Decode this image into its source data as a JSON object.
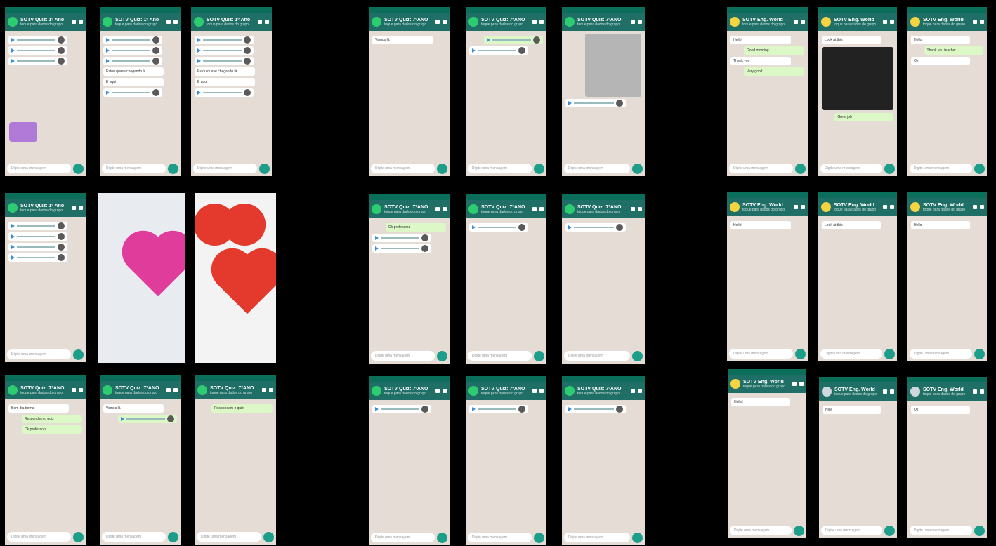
{
  "input_placeholder": "Digite uma mensagem",
  "groups": [
    {
      "title": "SOTV Quiz: 1º Ano",
      "subtitle": "toque para dados do grupo",
      "avatar": "green"
    },
    {
      "title": "SOTV Quiz: 7ºANO",
      "subtitle": "toque para dados do grupo",
      "avatar": "green"
    },
    {
      "title": "SOTV Eng. World",
      "subtitle": "toque para dados do grupo",
      "avatar": "yellow"
    }
  ],
  "screens": [
    {
      "type": "chat",
      "group": 0,
      "messages": [
        "Parabéns!",
        "audio",
        "audio",
        "audio",
        "audio"
      ],
      "sticker": true
    },
    {
      "type": "chat",
      "group": 0,
      "messages": [
        "audio",
        "audio",
        "audio",
        "Estou quase chegando lá",
        "É aqui",
        "audio"
      ]
    },
    {
      "type": "chat",
      "group": 0,
      "messages": [
        "audio",
        "audio",
        "audio",
        "Estou quase chegando lá",
        "É aqui",
        "audio"
      ]
    },
    {
      "type": "chat",
      "group": 1,
      "messages": [
        "Bom dia turma",
        "Respondam o quiz",
        "audio",
        "audio",
        "Ok professora"
      ]
    },
    {
      "type": "chat",
      "group": 1,
      "messages": [
        "audio",
        "audio",
        "audio",
        "Vamos lá",
        "audio"
      ]
    },
    {
      "type": "photo",
      "group": 1,
      "messages": [
        "foto"
      ]
    },
    {
      "type": "chat",
      "group": 2,
      "messages": [
        "Hello!",
        "audio",
        "Good morning",
        "Thank you",
        "Very good"
      ]
    },
    {
      "type": "chat",
      "group": 2,
      "messages": [
        "Look at this",
        "Great job",
        "audio",
        "Nice"
      ]
    },
    {
      "type": "chat",
      "group": 2,
      "messages": [
        "Hello",
        "audio",
        "Thank you teacher",
        "Ok"
      ]
    }
  ]
}
